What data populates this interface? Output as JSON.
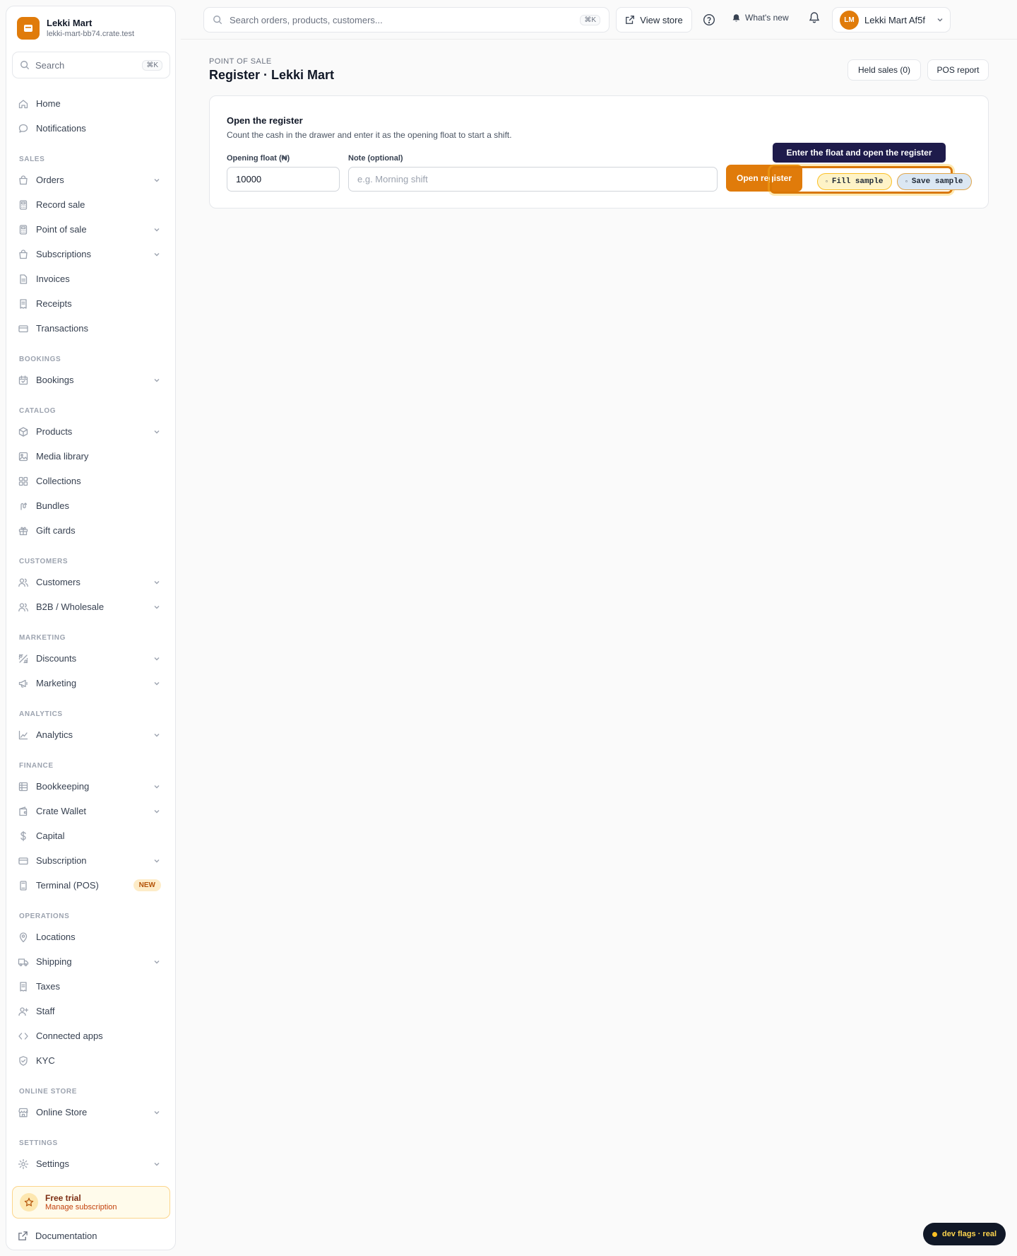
{
  "store": {
    "name": "Lekki Mart",
    "domain": "lekki-mart-bb74.crate.test"
  },
  "sidebar": {
    "search_placeholder": "Search",
    "search_shortcut": "⌘K",
    "sections": [
      {
        "title": "",
        "items": [
          {
            "label": "Home",
            "icon": "home-icon",
            "expandable": false
          },
          {
            "label": "Notifications",
            "icon": "chat-bubble-icon",
            "expandable": false
          }
        ]
      },
      {
        "title": "SALES",
        "items": [
          {
            "label": "Orders",
            "icon": "bag-icon",
            "expandable": true
          },
          {
            "label": "Record sale",
            "icon": "calculator-icon",
            "expandable": false
          },
          {
            "label": "Point of sale",
            "icon": "calculator-icon",
            "expandable": true
          },
          {
            "label": "Subscriptions",
            "icon": "bag-icon",
            "expandable": true
          },
          {
            "label": "Invoices",
            "icon": "document-icon",
            "expandable": false
          },
          {
            "label": "Receipts",
            "icon": "receipt-icon",
            "expandable": false
          },
          {
            "label": "Transactions",
            "icon": "credit-card-icon",
            "expandable": false
          }
        ]
      },
      {
        "title": "BOOKINGS",
        "items": [
          {
            "label": "Bookings",
            "icon": "calendar-icon",
            "expandable": true
          }
        ]
      },
      {
        "title": "CATALOG",
        "items": [
          {
            "label": "Products",
            "icon": "box-icon",
            "expandable": true
          },
          {
            "label": "Media library",
            "icon": "image-icon",
            "expandable": false
          },
          {
            "label": "Collections",
            "icon": "grid-icon",
            "expandable": false
          },
          {
            "label": "Bundles",
            "icon": "bundle-icon",
            "expandable": false
          },
          {
            "label": "Gift cards",
            "icon": "gift-icon",
            "expandable": false
          }
        ]
      },
      {
        "title": "CUSTOMERS",
        "items": [
          {
            "label": "Customers",
            "icon": "users-icon",
            "expandable": true
          },
          {
            "label": "B2B / Wholesale",
            "icon": "users-icon",
            "expandable": true
          }
        ]
      },
      {
        "title": "MARKETING",
        "items": [
          {
            "label": "Discounts",
            "icon": "discount-icon",
            "expandable": true
          },
          {
            "label": "Marketing",
            "icon": "megaphone-icon",
            "expandable": true
          }
        ]
      },
      {
        "title": "ANALYTICS",
        "items": [
          {
            "label": "Analytics",
            "icon": "chart-icon",
            "expandable": true
          }
        ]
      },
      {
        "title": "FINANCE",
        "items": [
          {
            "label": "Bookkeeping",
            "icon": "ledger-icon",
            "expandable": true
          },
          {
            "label": "Crate Wallet",
            "icon": "wallet-icon",
            "expandable": true
          },
          {
            "label": "Capital",
            "icon": "dollar-icon",
            "expandable": false
          },
          {
            "label": "Subscription",
            "icon": "credit-card-icon",
            "expandable": true
          },
          {
            "label": "Terminal (POS)",
            "icon": "terminal-icon",
            "expandable": false,
            "badge": "NEW"
          }
        ]
      },
      {
        "title": "OPERATIONS",
        "items": [
          {
            "label": "Locations",
            "icon": "pin-icon",
            "expandable": false
          },
          {
            "label": "Shipping",
            "icon": "truck-icon",
            "expandable": true
          },
          {
            "label": "Taxes",
            "icon": "receipt-icon",
            "expandable": false
          },
          {
            "label": "Staff",
            "icon": "user-plus-icon",
            "expandable": false
          },
          {
            "label": "Connected apps",
            "icon": "code-icon",
            "expandable": false
          },
          {
            "label": "KYC",
            "icon": "shield-icon",
            "expandable": false
          }
        ]
      },
      {
        "title": "ONLINE STORE",
        "items": [
          {
            "label": "Online Store",
            "icon": "storefront-icon",
            "expandable": true
          }
        ]
      },
      {
        "title": "SETTINGS",
        "items": [
          {
            "label": "Settings",
            "icon": "gear-icon",
            "expandable": true
          }
        ]
      }
    ],
    "trial": {
      "title": "Free trial",
      "subtitle": "Manage subscription"
    },
    "documentation": "Documentation"
  },
  "topbar": {
    "search_placeholder": "Search orders, products, customers...",
    "search_shortcut": "⌘K",
    "view_store": "View store",
    "whats_new": "What's new",
    "account": {
      "initials": "LM",
      "name": "Lekki Mart Af5f"
    }
  },
  "page": {
    "breadcrumb": "POINT OF SALE",
    "title": "Register · Lekki Mart",
    "held_sales": "Held sales (0)",
    "pos_report": "POS report"
  },
  "register": {
    "title": "Open the register",
    "description": "Count the cash in the drawer and enter it as the opening float to start a shift.",
    "float_label": "Opening float (₦)",
    "float_value": "10000",
    "note_label": "Note (optional)",
    "note_placeholder": "e.g. Morning shift",
    "open_button": "Open register"
  },
  "guide": {
    "tooltip": "Enter the float and open the register",
    "fill_sample": "Fill sample",
    "save_sample": "Save sample"
  },
  "dev_flags": "dev flags · real",
  "colors": {
    "accent": "#e07b0a",
    "tooltip_bg": "#1e1b4b",
    "devflags_bg": "#111827"
  }
}
